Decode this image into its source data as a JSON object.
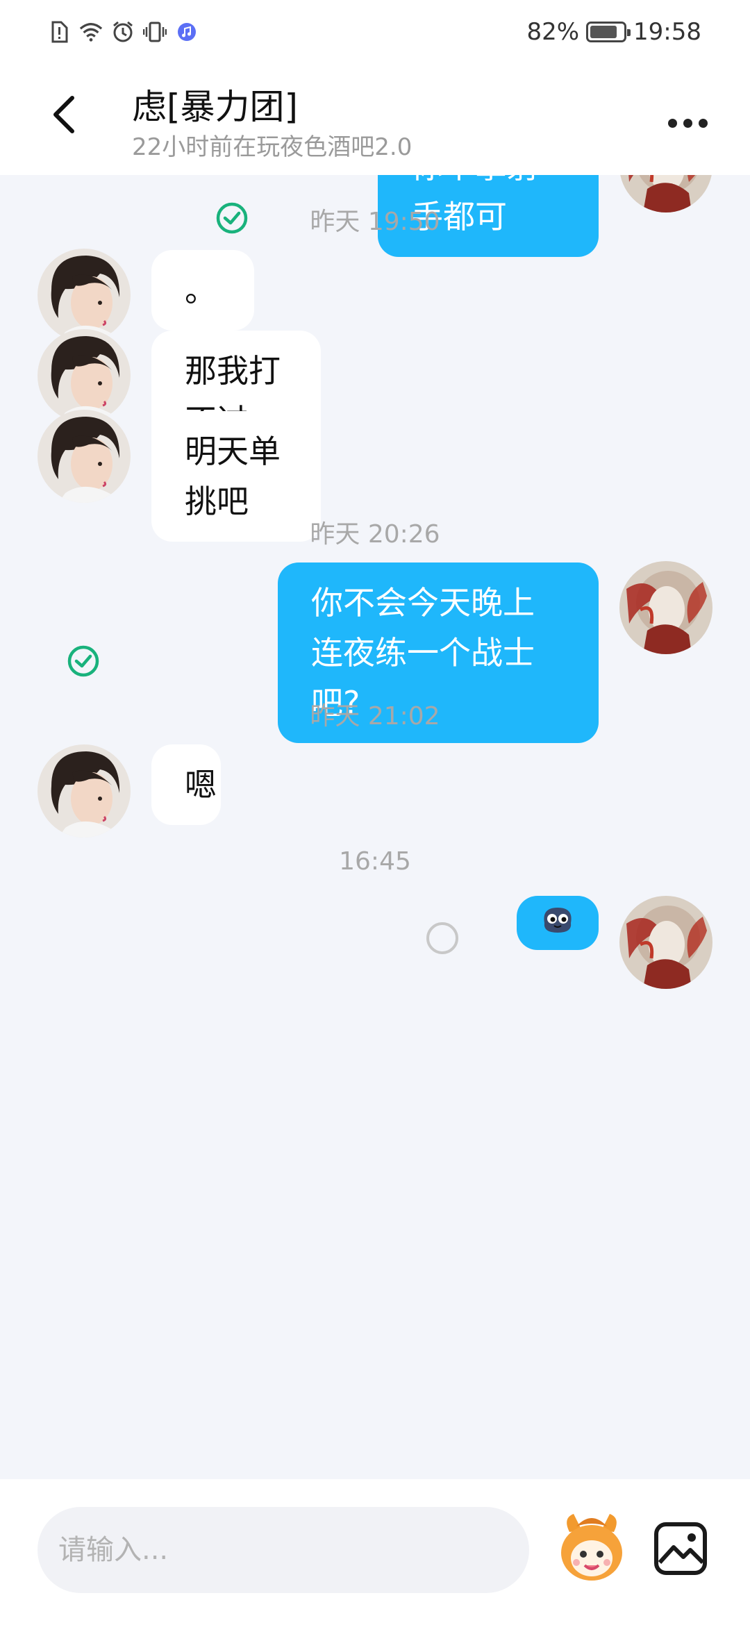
{
  "status_bar": {
    "battery": "82%",
    "battery_level": 0.82,
    "time": "19:58",
    "icons": [
      "sim-alert-icon",
      "wifi-icon",
      "alarm-icon",
      "vibrate-icon",
      "music-app-icon"
    ]
  },
  "header": {
    "contact_name": "虑[暴力团]",
    "contact_status": "22小时前在玩夜色酒吧2.0",
    "back_icon": "chevron-left-icon",
    "more_icon": "more-dots-icon"
  },
  "messages": [
    {
      "type": "out",
      "text": "你不拿射手都可",
      "status": "sent"
    },
    {
      "type": "time",
      "text": "昨天 19:50"
    },
    {
      "type": "in",
      "text": "。"
    },
    {
      "type": "in",
      "text": "那我打不过"
    },
    {
      "type": "in",
      "text": "明天单挑吧"
    },
    {
      "type": "time",
      "text": "昨天 20:26"
    },
    {
      "type": "out",
      "text": "你不会今天晚上连夜练一个战士吧?",
      "status": "sent"
    },
    {
      "type": "time",
      "text": "昨天 21:02"
    },
    {
      "type": "in",
      "text": "嗯"
    },
    {
      "type": "time",
      "text": "16:45"
    },
    {
      "type": "out",
      "sticker": "blob-face-sticker",
      "status": "pending"
    }
  ],
  "input_bar": {
    "placeholder": "请输入...",
    "emoji_icon": "mascot-emoji-icon",
    "image_icon": "image-icon"
  },
  "colors": {
    "accent": "#1fb7fb",
    "chat_background": "#f3f5fa",
    "sent_check": "#19b27c"
  }
}
